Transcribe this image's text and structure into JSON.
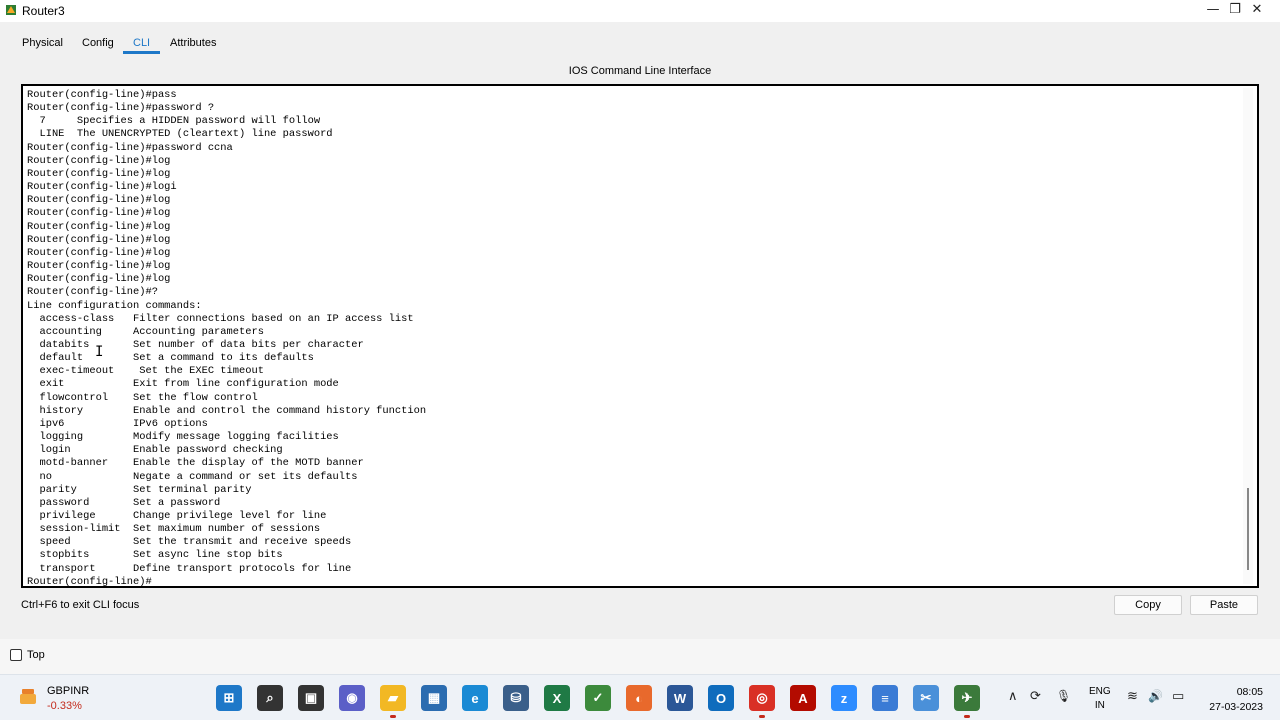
{
  "window": {
    "title": "Router3",
    "minimize": "—",
    "maximize": "❐",
    "close": "✕"
  },
  "tabs": [
    {
      "label": "Physical"
    },
    {
      "label": "Config"
    },
    {
      "label": "CLI"
    },
    {
      "label": "Attributes"
    }
  ],
  "cli": {
    "header": "IOS Command Line Interface",
    "lines": [
      "Router(config-line)#pass",
      "Router(config-line)#password ?",
      "  7     Specifies a HIDDEN password will follow",
      "  LINE  The UNENCRYPTED (cleartext) line password",
      "Router(config-line)#password ccna",
      "Router(config-line)#log",
      "Router(config-line)#log",
      "Router(config-line)#logi",
      "Router(config-line)#log",
      "Router(config-line)#log",
      "Router(config-line)#log",
      "Router(config-line)#log",
      "Router(config-line)#log",
      "Router(config-line)#log",
      "Router(config-line)#log",
      "Router(config-line)#?",
      "Line configuration commands:",
      "  access-class   Filter connections based on an IP access list",
      "  accounting     Accounting parameters",
      "  databits       Set number of data bits per character",
      "  default        Set a command to its defaults",
      "  exec-timeout    Set the EXEC timeout",
      "  exit           Exit from line configuration mode",
      "  flowcontrol    Set the flow control",
      "  history        Enable and control the command history function",
      "  ipv6           IPv6 options",
      "  logging        Modify message logging facilities",
      "  login          Enable password checking",
      "  motd-banner    Enable the display of the MOTD banner",
      "  no             Negate a command or set its defaults",
      "  parity         Set terminal parity",
      "  password       Set a password",
      "  privilege      Change privilege level for line",
      "  session-limit  Set maximum number of sessions",
      "  speed          Set the transmit and receive speeds",
      "  stopbits       Set async line stop bits",
      "  transport      Define transport protocols for line",
      "Router(config-line)#"
    ],
    "text_cursor": "I"
  },
  "footer": {
    "hint": "Ctrl+F6 to exit CLI focus",
    "copy_label": "Copy",
    "paste_label": "Paste",
    "top_label": "Top"
  },
  "taskbar": {
    "stock_name": "GBPINR",
    "stock_change": "-0.33%",
    "apps": [
      {
        "name": "start-icon",
        "glyph": "⊞",
        "color": "#1e78c8"
      },
      {
        "name": "search-icon",
        "glyph": "⌕",
        "color": "#333333"
      },
      {
        "name": "task-view-icon",
        "glyph": "▣",
        "color": "#333333"
      },
      {
        "name": "chat-icon",
        "glyph": "◉",
        "color": "#5b5fc7"
      },
      {
        "name": "file-explorer-icon",
        "glyph": "▰",
        "color": "#f2b824"
      },
      {
        "name": "store-icon",
        "glyph": "▦",
        "color": "#2b6cb0"
      },
      {
        "name": "edge-icon",
        "glyph": "e",
        "color": "#1a8ad4"
      },
      {
        "name": "network-app-icon",
        "glyph": "⛁",
        "color": "#3a5f8a"
      },
      {
        "name": "excel-icon",
        "glyph": "X",
        "color": "#1f7a45"
      },
      {
        "name": "project-icon",
        "glyph": "✓",
        "color": "#3c8a3c"
      },
      {
        "name": "firefox-icon",
        "glyph": "◐",
        "color": "#e8692c"
      },
      {
        "name": "word-icon",
        "glyph": "W",
        "color": "#2b5797"
      },
      {
        "name": "outlook-icon",
        "glyph": "O",
        "color": "#0f6cbd"
      },
      {
        "name": "chrome-icon",
        "glyph": "◎",
        "color": "#d93025"
      },
      {
        "name": "acrobat-icon",
        "glyph": "A",
        "color": "#b30b00"
      },
      {
        "name": "zoom-icon",
        "glyph": "z",
        "color": "#2d8cff"
      },
      {
        "name": "notepad-icon",
        "glyph": "≡",
        "color": "#3a7bd5"
      },
      {
        "name": "snipping-icon",
        "glyph": "✂",
        "color": "#4a90d9"
      },
      {
        "name": "packet-tracer-icon",
        "glyph": "✈",
        "color": "#3b7a3b"
      }
    ],
    "tray": {
      "chevron": "∧",
      "sync": "⟳",
      "mic": "🎙",
      "wifi": "≋",
      "volume": "🔊",
      "battery": "▭"
    },
    "lang_top": "ENG",
    "lang_bottom": "IN",
    "time": "08:05",
    "date": "27-03-2023"
  }
}
